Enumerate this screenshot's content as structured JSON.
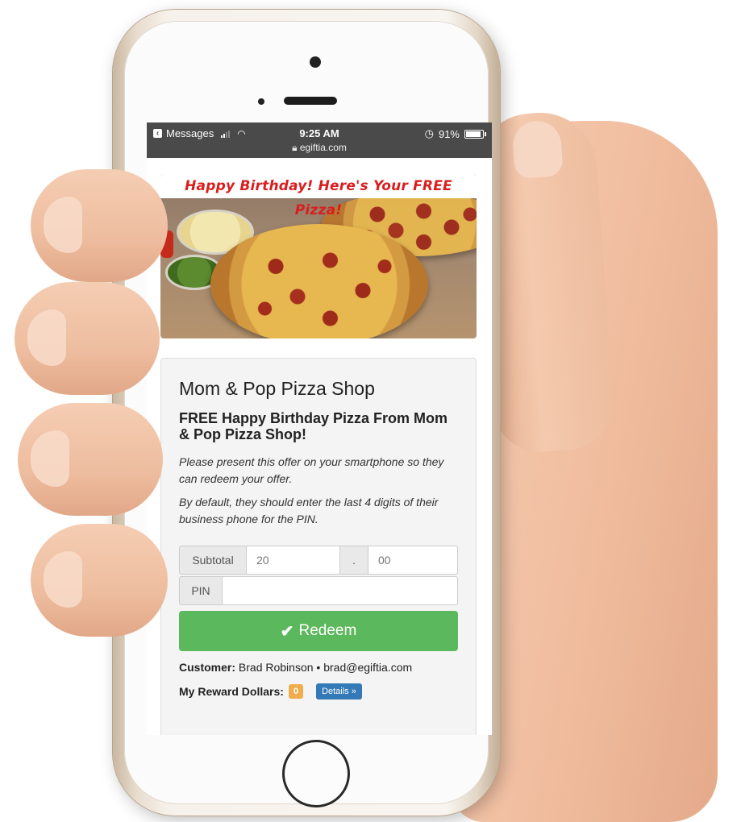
{
  "status_bar": {
    "back_app": "Messages",
    "time": "9:25 AM",
    "url": "egiftia.com",
    "battery": "91%"
  },
  "banner": {
    "title": "Happy Birthday! Here's Your FREE Pizza!"
  },
  "offer": {
    "shop_name": "Mom & Pop Pizza Shop",
    "title": "FREE Happy Birthday Pizza From Mom & Pop Pizza Shop!",
    "instruction_1": "Please present this offer on your smartphone so they can redeem your offer.",
    "instruction_2": "By default, they should enter the last 4 digits of their business phone for the PIN."
  },
  "form": {
    "subtotal_label": "Subtotal",
    "subtotal_dollars_placeholder": "20",
    "decimal_separator": ".",
    "subtotal_cents_placeholder": "00",
    "pin_label": "PIN",
    "pin_value": "",
    "redeem_label": "Redeem"
  },
  "customer": {
    "label": "Customer:",
    "name": "Brad Robinson",
    "separator": "•",
    "email": "brad@egiftia.com"
  },
  "rewards": {
    "label": "My Reward Dollars:",
    "value": "0",
    "details_label": "Details »"
  },
  "colors": {
    "redeem_green": "#5cb85c",
    "badge_orange": "#f0ad4e",
    "details_blue": "#337ab7",
    "banner_red": "#d81e1e",
    "status_bar_gray": "#4a4a4a"
  },
  "icons": {
    "back": "back-arrow-icon",
    "signal": "signal-icon",
    "wifi": "wifi-icon",
    "lock": "lock-icon",
    "alarm": "alarm-icon",
    "battery": "battery-icon",
    "check": "check-icon"
  }
}
